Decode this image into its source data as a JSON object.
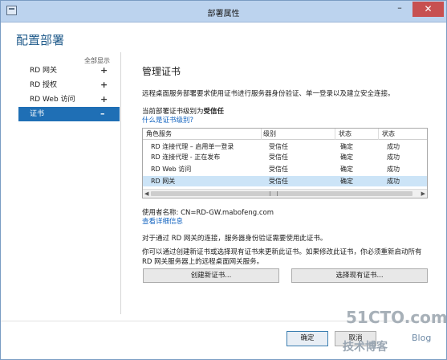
{
  "window": {
    "title": "部署属性",
    "minimize_glyph": "–",
    "close_glyph": "✕"
  },
  "dialog_title": "配置部署",
  "nav": {
    "show_all": "全部显示",
    "items": [
      {
        "label": "RD 网关",
        "sign": "+"
      },
      {
        "label": "RD 授权",
        "sign": "+"
      },
      {
        "label": "RD Web 访问",
        "sign": "+"
      },
      {
        "label": "证书",
        "sign": "–",
        "selected": true
      }
    ]
  },
  "pane": {
    "title": "管理证书",
    "description": "远程桌面服务部署要求使用证书进行服务器身份验证、单一登录以及建立安全连接。",
    "level_prefix": "当前部署证书级别为",
    "level_value": "受信任",
    "level_link": "什么是证书级别?"
  },
  "table": {
    "headers": [
      "角色服务",
      "级别",
      "状态",
      "状态"
    ],
    "rows": [
      {
        "role": "RD 连接代理 – 启用单一登录",
        "level": "受信任",
        "state": "确定",
        "status": "成功"
      },
      {
        "role": "RD 连接代理 - 正在发布",
        "level": "受信任",
        "state": "确定",
        "status": "成功"
      },
      {
        "role": "RD Web 访问",
        "level": "受信任",
        "state": "确定",
        "status": "成功"
      },
      {
        "role": "RD 网关",
        "level": "受信任",
        "state": "确定",
        "status": "成功",
        "selected": true
      }
    ]
  },
  "cert_info": {
    "issued_to": "使用者名称: CN=RD-GW.mabofeng.com",
    "details_link": "查看详细信息"
  },
  "notes": {
    "note1": "对于通过 RD 网关的连接，服务器身份验证需要使用此证书。",
    "note2": "你可以通过创建新证书或选择现有证书来更新此证书。如果修改此证书，你必须重新启动所有 RD 网关服务器上的远程桌面网关服务。"
  },
  "buttons": {
    "create_new": "创建新证书...",
    "select_existing": "选择现有证书...",
    "ok": "确定",
    "cancel": "取消"
  },
  "watermark": {
    "site": "51CTO.com",
    "sub": "技术博客",
    "blog": "Blog"
  }
}
